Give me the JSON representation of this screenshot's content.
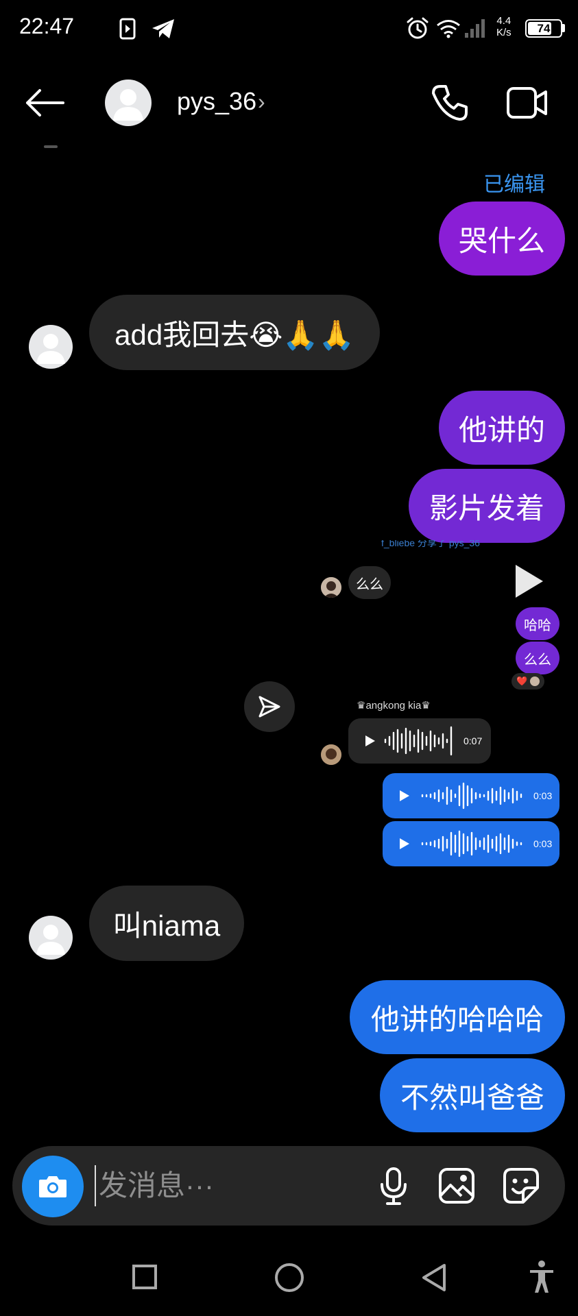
{
  "status_bar": {
    "time": "22:47",
    "net_speed_value": "4.4",
    "net_speed_unit": "K/s",
    "battery": "74",
    "icons": [
      "video-app-icon",
      "telegram-icon",
      "alarm-icon",
      "wifi-icon",
      "signal-icon",
      "battery-icon"
    ]
  },
  "header": {
    "username": "pys_36",
    "chevron": "›",
    "icons": [
      "back-arrow-icon",
      "phone-icon",
      "video-call-icon"
    ]
  },
  "messages": {
    "edited_label": "已编辑",
    "m1": "哭什么",
    "m2": "add我回去😭🙏🙏",
    "m3": "他讲的",
    "m4": "影片发着",
    "shared_header": "f_bliebe 分享了 pys_36",
    "shared_reply": "么么",
    "small_1": "哈哈",
    "small_2": "么么",
    "reaction": "❤️",
    "voice_sender": "♛angkong kia♛",
    "voice_1_duration": "0:07",
    "voice_2_duration": "0:03",
    "voice_3_duration": "0:03",
    "m5": "叫niama",
    "m6": "他讲的哈哈哈",
    "m7": "不然叫爸爸"
  },
  "input": {
    "placeholder": "发消息···",
    "value": ""
  },
  "colors": {
    "bubble_purple": "#8a1ed6",
    "bubble_violet": "#7329d4",
    "bubble_blue": "#1f6fe8",
    "bubble_gray": "#262626",
    "accent_blue": "#1e8df0",
    "edited_text": "#3a95f0"
  },
  "nav": [
    "recents-square-icon",
    "home-circle-icon",
    "back-triangle-icon",
    "accessibility-icon"
  ]
}
